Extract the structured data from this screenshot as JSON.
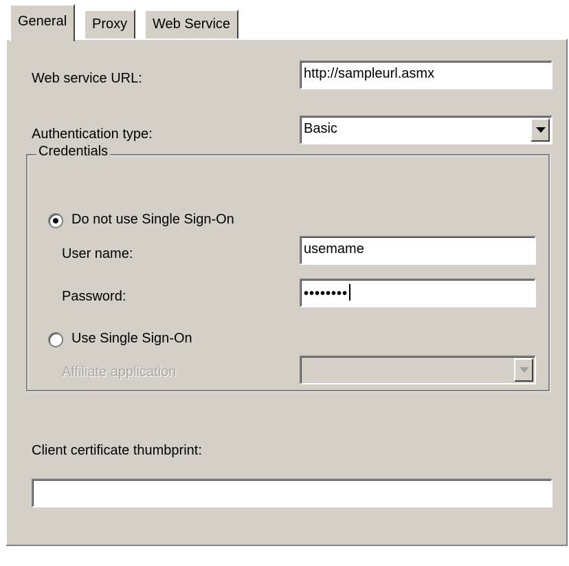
{
  "tabs": [
    {
      "label": "General",
      "active": true
    },
    {
      "label": "Proxy",
      "active": false
    },
    {
      "label": "Web Service",
      "active": false
    }
  ],
  "general": {
    "url_label": "Web service URL:",
    "url_value": "http://sampleurl.asmx",
    "auth_label": "Authentication type:",
    "auth_value": "Basic",
    "credentials": {
      "legend": "Credentials",
      "radio_no_sso_label": "Do not use Single Sign-On",
      "radio_no_sso_checked": true,
      "username_label": "User name:",
      "username_value": "usemame",
      "password_label": "Password:",
      "password_masked": "••••••••",
      "radio_sso_label": "Use Single Sign-On",
      "radio_sso_checked": false,
      "affiliate_label": "Affiliate application",
      "affiliate_value": ""
    },
    "cert_label": "Client certificate thumbprint:",
    "cert_value": ""
  },
  "icons": {
    "dropdown_arrow": "chevron-down-icon",
    "radio_selected": "radio-selected-icon"
  },
  "colors": {
    "dialog_background": "#d4d0c8",
    "field_background": "#ffffff",
    "disabled_text": "#a8a8a8"
  }
}
